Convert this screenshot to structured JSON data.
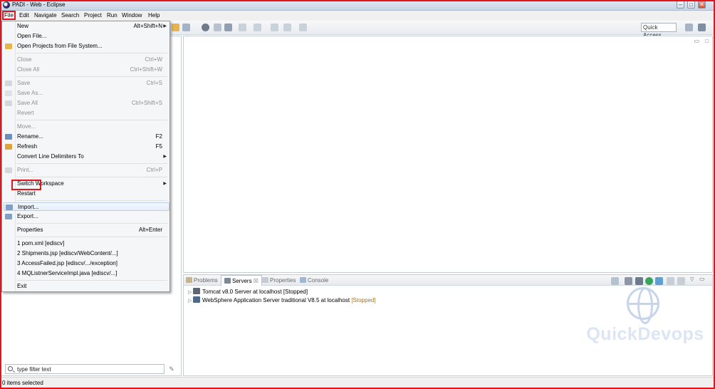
{
  "window": {
    "title": "PADI - Web - Eclipse"
  },
  "menubar": [
    "File",
    "Edit",
    "Navigate",
    "Search",
    "Project",
    "Run",
    "Window",
    "Help"
  ],
  "file_menu": [
    {
      "label": "New",
      "shortcut": "Alt+Shift+N",
      "submenu": true,
      "enabled": true
    },
    {
      "label": "Open File...",
      "shortcut": "",
      "enabled": true
    },
    {
      "label": "Open Projects from File System...",
      "shortcut": "",
      "enabled": true
    },
    {
      "label": "Close",
      "shortcut": "Ctrl+W",
      "enabled": false
    },
    {
      "label": "Close All",
      "shortcut": "Ctrl+Shift+W",
      "enabled": false
    },
    {
      "label": "Save",
      "shortcut": "Ctrl+S",
      "enabled": false
    },
    {
      "label": "Save As...",
      "shortcut": "",
      "enabled": false
    },
    {
      "label": "Save All",
      "shortcut": "Ctrl+Shift+S",
      "enabled": false
    },
    {
      "label": "Revert",
      "shortcut": "",
      "enabled": false
    },
    {
      "label": "Move...",
      "shortcut": "",
      "enabled": false
    },
    {
      "label": "Rename...",
      "shortcut": "F2",
      "enabled": true
    },
    {
      "label": "Refresh",
      "shortcut": "F5",
      "enabled": true
    },
    {
      "label": "Convert Line Delimiters To",
      "shortcut": "",
      "submenu": true,
      "enabled": true
    },
    {
      "label": "Print...",
      "shortcut": "Ctrl+P",
      "enabled": false
    },
    {
      "label": "Switch Workspace",
      "shortcut": "",
      "submenu": true,
      "enabled": true
    },
    {
      "label": "Restart",
      "shortcut": "",
      "enabled": true
    },
    {
      "label": "Import...",
      "shortcut": "",
      "enabled": true,
      "highlighted": true
    },
    {
      "label": "Export...",
      "shortcut": "",
      "enabled": true
    },
    {
      "label": "Properties",
      "shortcut": "Alt+Enter",
      "enabled": true
    },
    {
      "label": "1 pom.xml  [ediscv]",
      "shortcut": "",
      "enabled": true
    },
    {
      "label": "2 Shipments.jsp  [ediscv/WebContent/...]",
      "shortcut": "",
      "enabled": true
    },
    {
      "label": "3 AccessFailed.jsp  [ediscv/.../exception]",
      "shortcut": "",
      "enabled": true
    },
    {
      "label": "4 MQListnerServiceImpl.java  [ediscv/...]",
      "shortcut": "",
      "enabled": true
    },
    {
      "label": "Exit",
      "shortcut": "",
      "enabled": true
    }
  ],
  "toolbar": {
    "quick_access": "Quick Access"
  },
  "bottom_tabs": [
    {
      "label": "Problems"
    },
    {
      "label": "Servers",
      "active": true,
      "close": "☒"
    },
    {
      "label": "Properties"
    },
    {
      "label": "Console"
    }
  ],
  "servers": [
    {
      "name": "Tomcat v8.0 Server at localhost",
      "status": "[Stopped]"
    },
    {
      "name": "WebSphere Application Server traditional V8.5 at localhost",
      "status": "[Stopped]"
    }
  ],
  "filter": {
    "placeholder": "type filter text"
  },
  "status": {
    "text": "0 items selected"
  },
  "watermark": "QuickDevops",
  "colors": {
    "highlight_red": "#e3141b",
    "stopped_orange": "#a0772c"
  }
}
